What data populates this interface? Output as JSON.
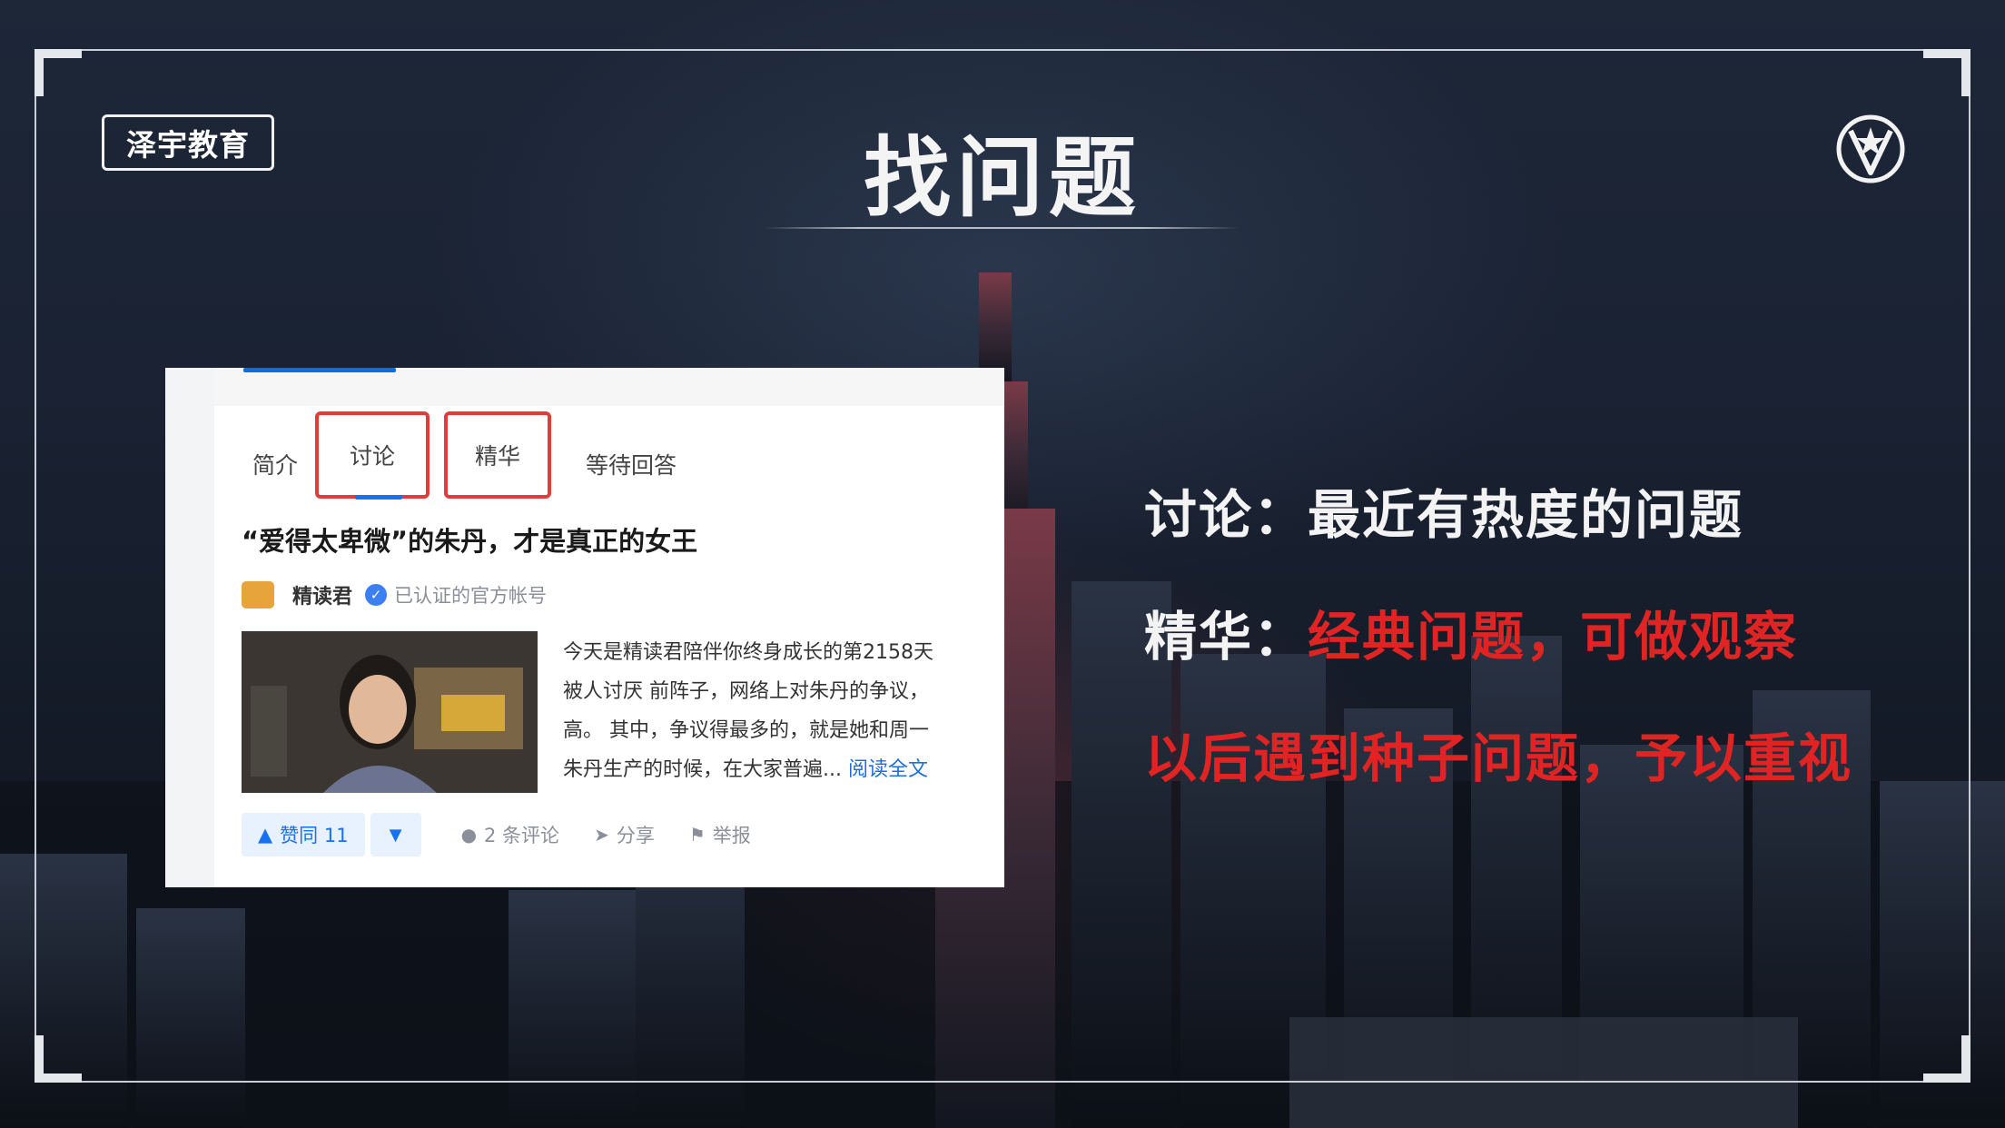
{
  "slide": {
    "logo_text": "泽宇教育",
    "title": "找问题"
  },
  "screenshot": {
    "tabs": [
      "简介",
      "讨论",
      "精华",
      "等待回答"
    ],
    "post_title": "“爱得太卑微”的朱丹，才是真正的女王",
    "author_name": "精读君",
    "author_desc": "已认证的官方帐号",
    "excerpt_lines": [
      "今天是精读君陪伴你终身成长的第2158天",
      "被人讨厌 前阵子，网络上对朱丹的争议，",
      "高。 其中，争议得最多的，就是她和周一",
      "朱丹生产的时候，在大家普遍..."
    ],
    "read_more": "阅读全文",
    "actions": {
      "upvote": "赞同 11",
      "downvote_icon": "triangle-down-icon",
      "comments": "2 条评论",
      "share": "分享",
      "report": "举报"
    }
  },
  "right_text": {
    "line1_label": "讨论：",
    "line1_text": "最近有热度的问题",
    "line2_label": "精华：",
    "line2_text": "经典问题，可做观察",
    "line3_text": "以后遇到种子问题，予以重视"
  },
  "colors": {
    "accent_red": "#e02424",
    "accent_blue": "#1772f0",
    "background": "#1a2233"
  }
}
